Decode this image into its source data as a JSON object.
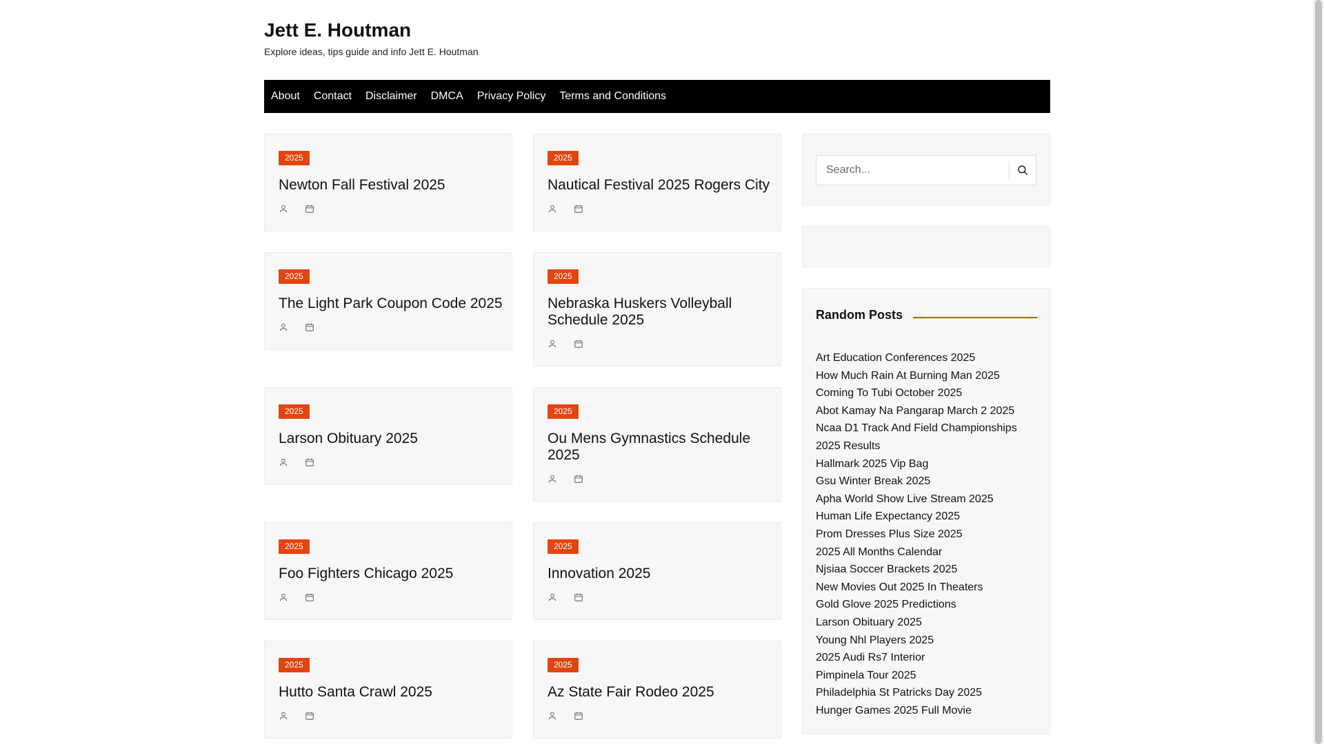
{
  "site": {
    "title": "Jett E. Houtman",
    "description": "Explore ideas, tips guide and info Jett E. Houtman"
  },
  "nav": [
    "About",
    "Contact",
    "Disclaimer",
    "DMCA",
    "Privacy Policy",
    "Terms and Conditions"
  ],
  "posts": [
    {
      "category": "2025",
      "title": "Newton Fall Festival 2025"
    },
    {
      "category": "2025",
      "title": "Nautical Festival 2025 Rogers City"
    },
    {
      "category": "2025",
      "title": "The Light Park Coupon Code 2025"
    },
    {
      "category": "2025",
      "title": "Nebraska Huskers Volleyball Schedule 2025"
    },
    {
      "category": "2025",
      "title": "Larson Obituary 2025"
    },
    {
      "category": "2025",
      "title": "Ou Mens Gymnastics Schedule 2025"
    },
    {
      "category": "2025",
      "title": "Foo Fighters Chicago 2025"
    },
    {
      "category": "2025",
      "title": "Innovation 2025"
    },
    {
      "category": "2025",
      "title": "Hutto Santa Crawl 2025"
    },
    {
      "category": "2025",
      "title": "Az State Fair Rodeo 2025"
    }
  ],
  "search": {
    "placeholder": "Search..."
  },
  "random_posts": {
    "title": "Random Posts",
    "items": [
      "Art Education Conferences 2025",
      "How Much Rain At Burning Man 2025",
      "Coming To Tubi October 2025",
      "Abot Kamay Na Pangarap March 2 2025",
      "Ncaa D1 Track And Field Championships 2025 Results",
      "Hallmark 2025 Vip Bag",
      "Gsu Winter Break 2025",
      "Apha World Show Live Stream 2025",
      "Human Life Expectancy 2025",
      "Prom Dresses Plus Size 2025",
      "2025 All Months Calendar",
      "Njsiaa Soccer Brackets 2025",
      "New Movies Out 2025 In Theaters",
      "Gold Glove 2025 Predictions",
      "Larson Obituary 2025",
      "Young Nhl Players 2025",
      "2025 Audi Rs7 Interior",
      "Pimpinela Tour 2025",
      "Philadelphia St Patricks Day 2025",
      "Hunger Games 2025 Full Movie"
    ]
  },
  "colors": {
    "accent": "#e4440f",
    "nav_bg": "#000000",
    "card_bg": "#f7f7f7"
  },
  "icons": {
    "author": "user-icon",
    "date": "calendar-icon",
    "search": "search-icon"
  }
}
